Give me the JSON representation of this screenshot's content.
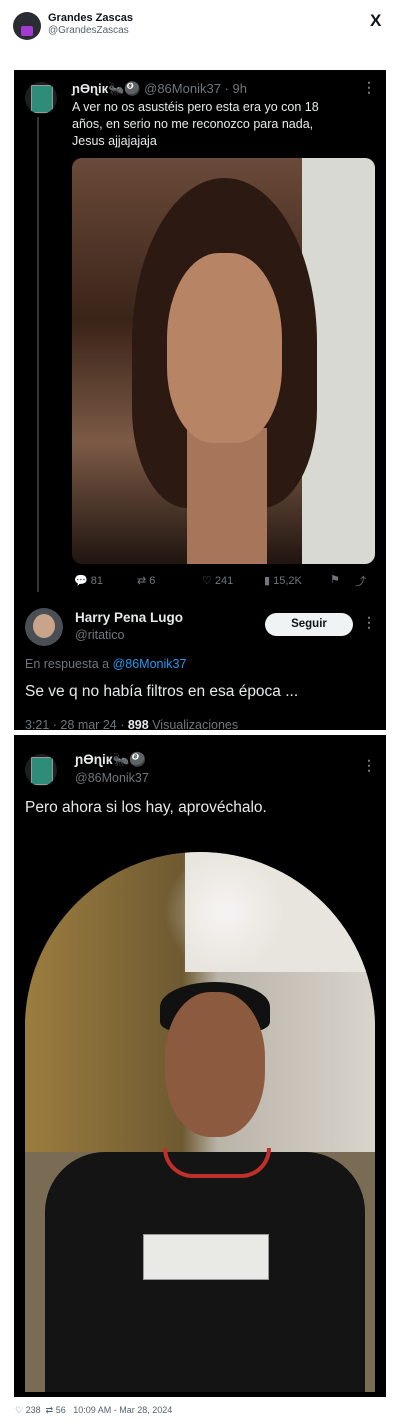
{
  "outer": {
    "name": "Grandes Zascas",
    "handle": "@GrandesZascas",
    "logo": "X"
  },
  "tweet1": {
    "display_name": "ɲϴɳік🐜🎱",
    "handle": "@86Monik37",
    "time": "· 9h",
    "text_lines": [
      "A ver no os asustéis pero esta era yo con 18",
      "años, en serio no me reconozco para nada,",
      "Jesus ajjajajaja"
    ],
    "stats": {
      "replies": "81",
      "retweets": "6",
      "likes": "241",
      "views": "15,2K"
    }
  },
  "reply": {
    "display_name": "Harry Pena Lugo",
    "handle": "@ritatico",
    "follow_label": "Seguir",
    "in_reply_prefix": "En respuesta a",
    "in_reply_handle": "@86Monik37",
    "text": "Se ve q no había filtros en esa época ...",
    "time": "3:21 · 28 mar 24 ·",
    "views_count": "898",
    "views_label": "Visualizaciones"
  },
  "tweet2": {
    "display_name": "ɲϴɳік🐜🎱",
    "handle": "@86Monik37",
    "text": "Pero ahora si los hay, aprovéchalo."
  },
  "footer": {
    "likes": "238",
    "retweets": "56",
    "timestamp": "10:09 AM - Mar 28, 2024"
  },
  "colors": {
    "panel_bg": "#000000",
    "text": "#e7e9ea",
    "muted": "#71767b",
    "link": "#1d9bf0"
  }
}
